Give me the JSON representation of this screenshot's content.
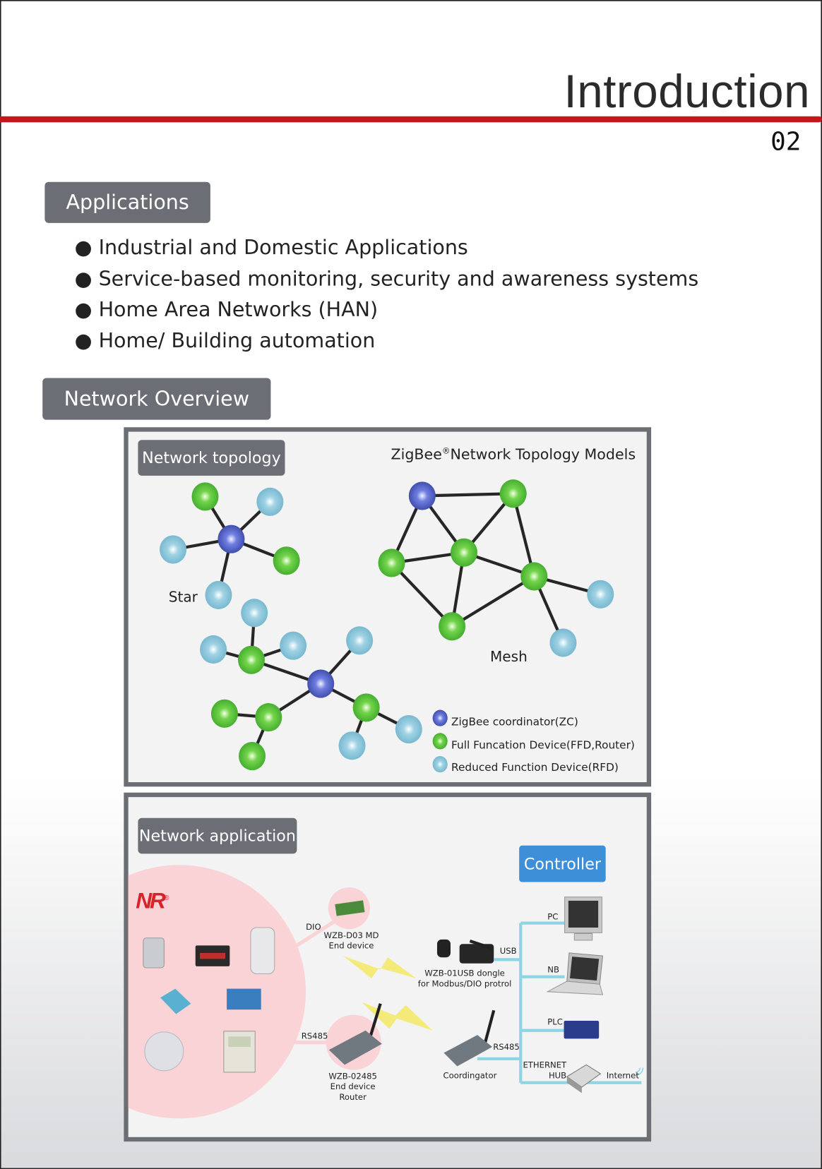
{
  "header": {
    "title": "Introduction",
    "page_number": "02",
    "accent_color": "#c4161c"
  },
  "applications": {
    "heading": "Applications",
    "bullets": [
      "● Industrial and Domestic Applications",
      "● Service-based monitoring, security and awareness systems",
      "● Home Area Networks (HAN)",
      "● Home/ Building automation"
    ]
  },
  "network_overview": {
    "heading": "Network Overview",
    "topology": {
      "badge": "Network topology",
      "title": "ZigBee",
      "title_reg": "®",
      "title_rest": "Network Topology Models",
      "star_label": "Star",
      "mesh_label": "Mesh",
      "legend": [
        {
          "label": "ZigBee coordinator(ZC)",
          "type": "zc",
          "color": "#4a5cc8"
        },
        {
          "label": "Full Funcation Device(FFD,Router)",
          "type": "ffd",
          "color": "#5ec83a"
        },
        {
          "label": "Reduced Function Device(RFD)",
          "type": "rfd",
          "color": "#8cc8de"
        }
      ]
    },
    "application": {
      "badge": "Network application",
      "controller": "Controller",
      "controller_color": "#3d8fd8",
      "logo": "NR",
      "logo_reg": "®",
      "labels": {
        "dio": "DIO",
        "d03_name": "WZB-D03 MD",
        "d03_role": "End device",
        "usb": "USB",
        "dongle_name": "WZB-01USB dongle",
        "dongle_desc": "for Modbus/DIO protrol",
        "pc": "PC",
        "nb": "NB",
        "plc": "PLC",
        "rs485_left": "RS485",
        "rs485_right": "RS485",
        "ethernet": "ETHERNET",
        "hub": "HUB",
        "internet": "Internet",
        "router_name": "WZB-02485",
        "router_role1": "End device",
        "router_role2": "Router",
        "coordinator": "Coordingator"
      }
    }
  }
}
